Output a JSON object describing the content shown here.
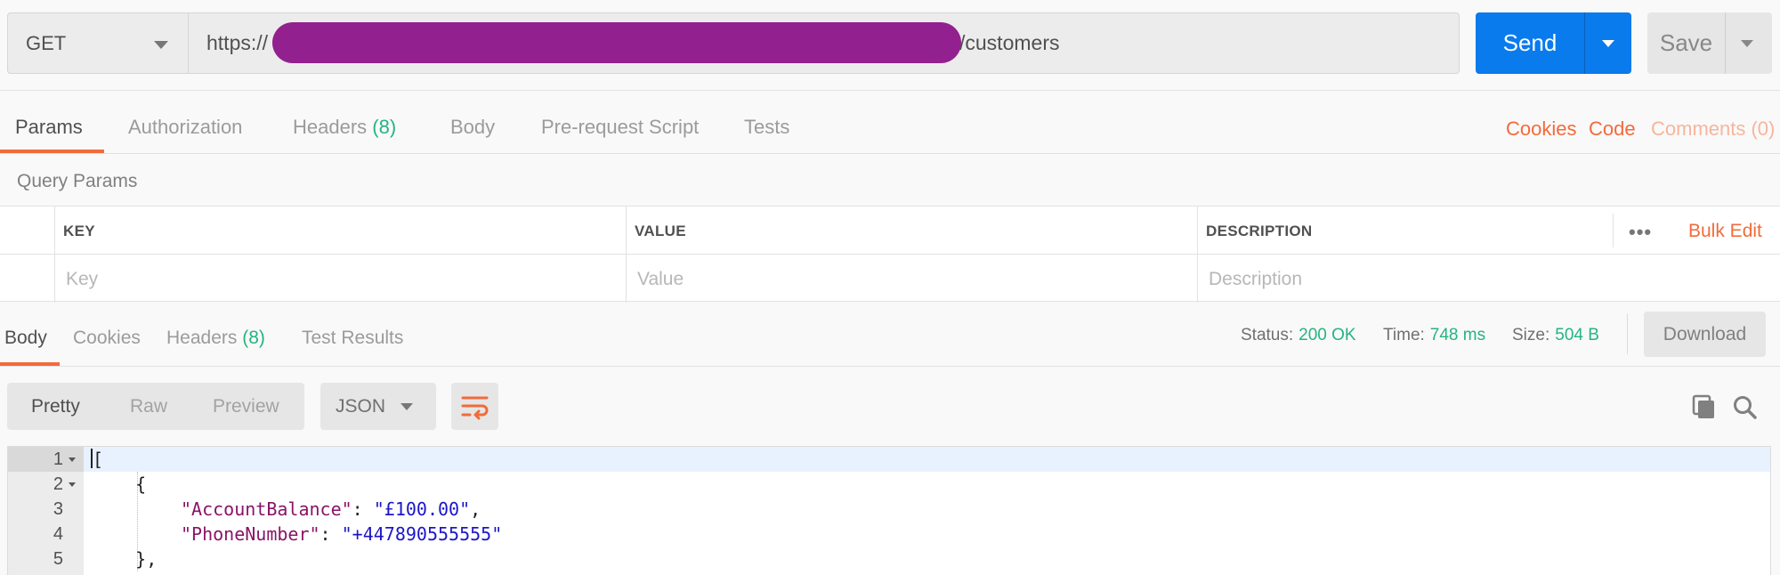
{
  "request": {
    "method": "GET",
    "url_prefix": "https://",
    "url_suffix": "/customers",
    "send_label": "Send",
    "save_label": "Save"
  },
  "request_tabs": [
    {
      "label": "Params",
      "count": ""
    },
    {
      "label": "Authorization",
      "count": ""
    },
    {
      "label": "Headers",
      "count": "(8)"
    },
    {
      "label": "Body",
      "count": ""
    },
    {
      "label": "Pre-request Script",
      "count": ""
    },
    {
      "label": "Tests",
      "count": ""
    }
  ],
  "right_links": {
    "cookies": "Cookies",
    "code": "Code",
    "comments": "Comments (0)"
  },
  "query_params": {
    "title": "Query Params",
    "headers": {
      "key": "KEY",
      "value": "VALUE",
      "description": "DESCRIPTION"
    },
    "placeholders": {
      "key": "Key",
      "value": "Value",
      "description": "Description"
    },
    "more": "•••",
    "bulk_edit": "Bulk Edit"
  },
  "response_tabs": [
    {
      "label": "Body",
      "count": ""
    },
    {
      "label": "Cookies",
      "count": ""
    },
    {
      "label": "Headers",
      "count": "(8)"
    },
    {
      "label": "Test Results",
      "count": ""
    }
  ],
  "response_meta": {
    "status_label": "Status:",
    "status": "200 OK",
    "time_label": "Time:",
    "time": "748 ms",
    "size_label": "Size:",
    "size": "504 B",
    "download": "Download"
  },
  "format": {
    "options": [
      "Pretty",
      "Raw",
      "Preview"
    ],
    "selected": "Pretty",
    "language": "JSON"
  },
  "icons": {
    "wrap": "wrap-lines-icon",
    "copy": "copy-icon",
    "search": "search-icon"
  },
  "colors": {
    "accent": "#f26b3a",
    "send": "#097bed",
    "success": "#26b47f",
    "redaction": "#93208f"
  },
  "code_lines": [
    {
      "num": "1",
      "text": "["
    },
    {
      "num": "2",
      "text": "    {"
    },
    {
      "num": "3",
      "key": "\"AccountBalance\"",
      "value": "\"£100.00\"",
      "trail": ","
    },
    {
      "num": "4",
      "key": "\"PhoneNumber\"",
      "value": "\"+447890555555\"",
      "trail": ""
    },
    {
      "num": "5",
      "text": "    },"
    }
  ]
}
